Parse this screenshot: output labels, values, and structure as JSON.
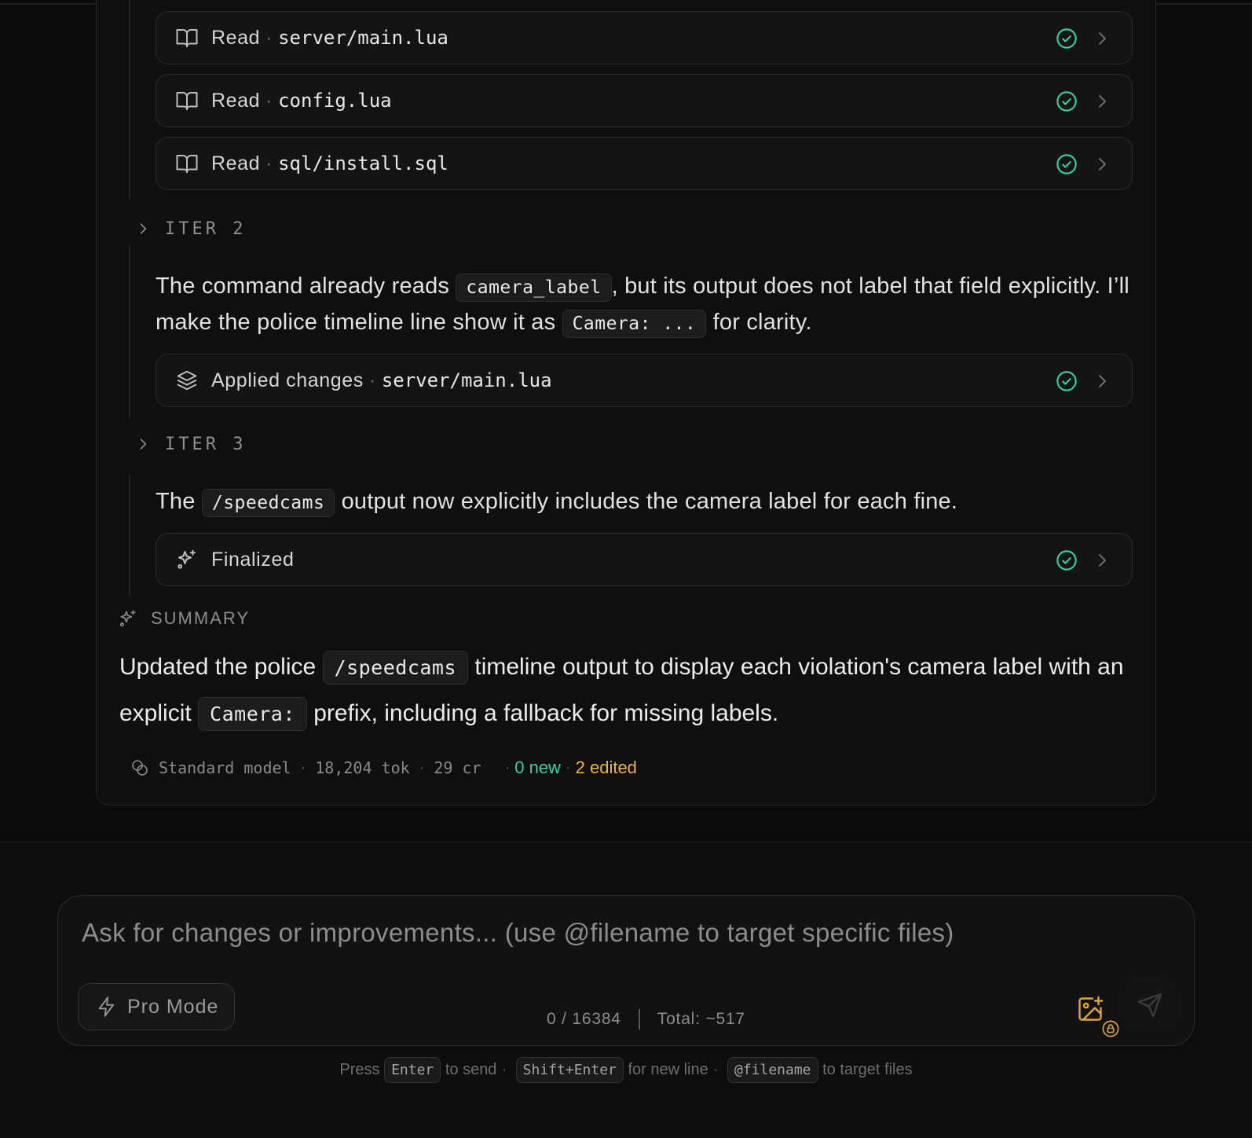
{
  "tools": [
    {
      "verb": "Read",
      "path": "server/main.lua",
      "icon": "book-open-icon",
      "status": "success"
    },
    {
      "verb": "Read",
      "path": "config.lua",
      "icon": "book-open-icon",
      "status": "success"
    },
    {
      "verb": "Read",
      "path": "sql/install.sql",
      "icon": "book-open-icon",
      "status": "success"
    },
    {
      "verb": "Applied changes",
      "path": "server/main.lua",
      "icon": "layers-icon",
      "status": "success"
    },
    {
      "verb": "Finalized",
      "path": "",
      "icon": "sparkles-icon",
      "status": "success"
    }
  ],
  "iterations": [
    {
      "label": "ITER 2"
    },
    {
      "label": "ITER 3"
    }
  ],
  "iter2_message": {
    "part1": "The command already reads ",
    "code1": "camera_label",
    "part2": ", but its output does not label that field explicitly. I’ll make the police timeline line show it as ",
    "code2": "Camera: ...",
    "part3": " for clarity."
  },
  "iter3_message": {
    "part1": "The ",
    "code1": "/speedcams",
    "part2": " output now explicitly includes the camera label for each fine."
  },
  "summary": {
    "heading": "SUMMARY",
    "part1": "Updated the police ",
    "code1": "/speedcams",
    "part2": " timeline output to display each violation's camera label with an explicit ",
    "code2": "Camera:",
    "part3": " prefix, including a fallback for missing labels."
  },
  "meta": {
    "model": "Standard model",
    "tokens": "18,204 tok",
    "credits": "29 cr",
    "new_files": "0 new",
    "edited_files": "2 edited"
  },
  "composer": {
    "placeholder": "Ask for changes or improvements... (use @filename to target specific files)",
    "value": "",
    "pro_mode_label": "Pro Mode",
    "char_count": "0 / 16384",
    "total": "Total: ~517"
  },
  "hint": {
    "press": "Press",
    "key_send": "Enter",
    "to_send": "to send",
    "key_newline": "Shift+Enter",
    "for_newline": "for new line",
    "key_target": "@filename",
    "to_target": "to target files"
  },
  "colors": {
    "success": "#35d3a0",
    "edited": "#f0b43c",
    "background": "#0d0d0d"
  }
}
